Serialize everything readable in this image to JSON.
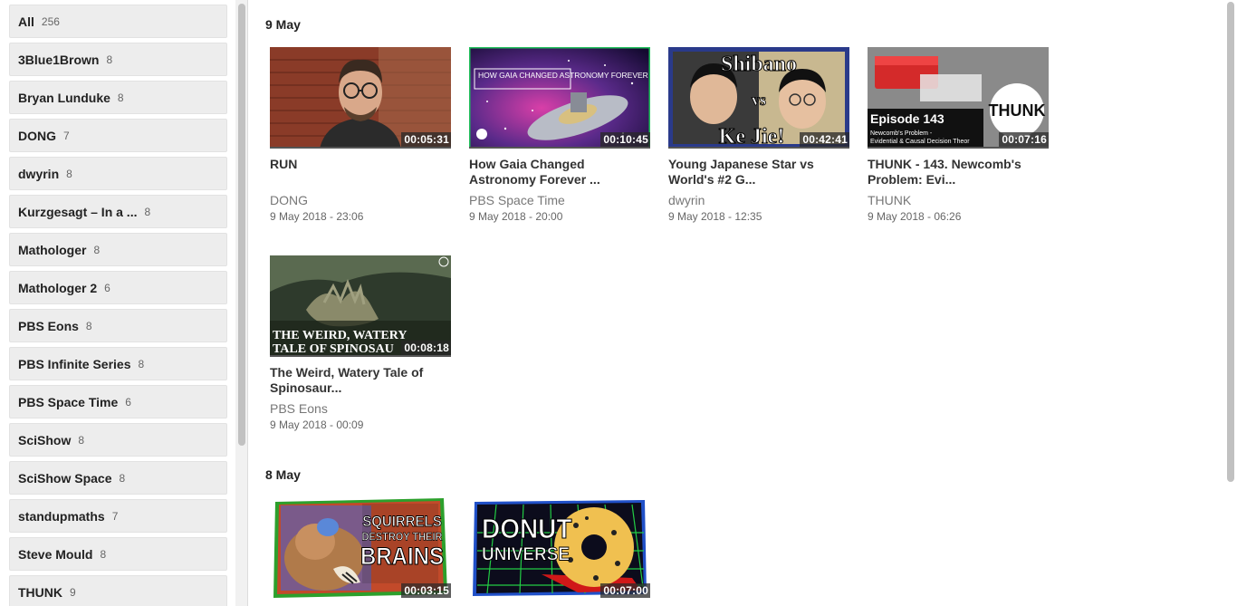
{
  "sidebar": {
    "items": [
      {
        "name": "All",
        "count": "256"
      },
      {
        "name": "3Blue1Brown",
        "count": "8"
      },
      {
        "name": "Bryan Lunduke",
        "count": "8"
      },
      {
        "name": "DONG",
        "count": "7"
      },
      {
        "name": "dwyrin",
        "count": "8"
      },
      {
        "name": "Kurzgesagt – In a ...",
        "count": "8"
      },
      {
        "name": "Mathologer",
        "count": "8"
      },
      {
        "name": "Mathologer 2",
        "count": "6"
      },
      {
        "name": "PBS Eons",
        "count": "8"
      },
      {
        "name": "PBS Infinite Series",
        "count": "8"
      },
      {
        "name": "PBS Space Time",
        "count": "6"
      },
      {
        "name": "SciShow",
        "count": "8"
      },
      {
        "name": "SciShow Space",
        "count": "8"
      },
      {
        "name": "standupmaths",
        "count": "7"
      },
      {
        "name": "Steve Mould",
        "count": "8"
      },
      {
        "name": "THUNK",
        "count": "9"
      }
    ]
  },
  "days": [
    {
      "heading": "9 May",
      "videos": [
        {
          "title": "RUN",
          "channel": "DONG",
          "date": "9 May 2018 - 23:06",
          "duration": "00:05:31"
        },
        {
          "title": "How Gaia Changed Astronomy Forever ...",
          "channel": "PBS Space Time",
          "date": "9 May 2018 - 20:00",
          "duration": "00:10:45",
          "thumb_text": "HOW GAIA CHANGED ASTRONOMY FOREVER"
        },
        {
          "title": "Young Japanese Star vs World's #2 G...",
          "channel": "dwyrin",
          "date": "9 May 2018 - 12:35",
          "duration": "00:42:41",
          "thumb_text_top": "Shibano",
          "thumb_text_mid": "vs",
          "thumb_text_bottom": "Ke Jie!"
        },
        {
          "title": "THUNK - 143. Newcomb's Problem: Evi...",
          "channel": "THUNK",
          "date": "9 May 2018 - 06:26",
          "duration": "00:07:16",
          "thumb_text_episode": "Episode 143",
          "thumb_text_logo": "THUNK",
          "thumb_text_sub1": "Newcomb's Problem -",
          "thumb_text_sub2": "Evidential & Causal Decision Theor"
        },
        {
          "title": "The Weird, Watery Tale of Spinosaur...",
          "channel": "PBS Eons",
          "date": "9 May 2018 - 00:09",
          "duration": "00:08:18",
          "thumb_text1": "THE WEIRD, WATERY",
          "thumb_text2": "TALE OF SPINOSAU"
        }
      ]
    },
    {
      "heading": "8 May",
      "videos": [
        {
          "title": "",
          "channel": "",
          "date": "",
          "duration": "00:03:15",
          "thumb_text1": "SQUIRRELS",
          "thumb_text2": "DESTROY THEIR",
          "thumb_text3": "BRAINS"
        },
        {
          "title": "",
          "channel": "",
          "date": "",
          "duration": "00:07:00",
          "thumb_text1": "DONUT",
          "thumb_text2": "UNIVERSE"
        }
      ]
    }
  ]
}
